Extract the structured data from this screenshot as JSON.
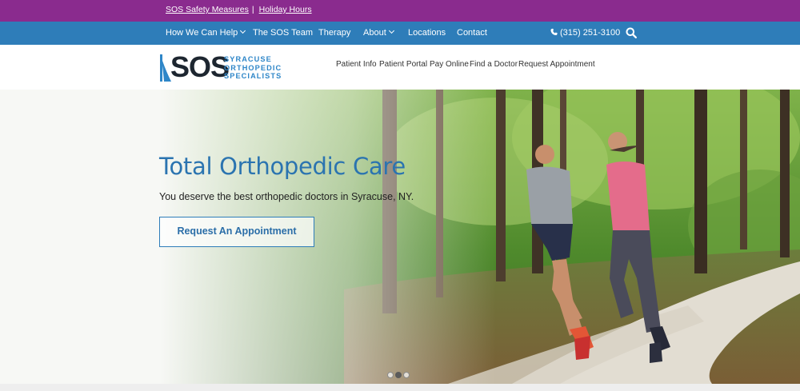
{
  "topbar": {
    "links": [
      "SOS Safety Measures",
      "Holiday Hours"
    ],
    "separator": "|"
  },
  "nav": {
    "items": [
      "How We Can Help",
      "The SOS Team",
      "Therapy",
      "About",
      "Locations",
      "Contact"
    ],
    "phone": "(315) 251-3100",
    "icons": {
      "phone": "phone-icon",
      "search": "search-icon"
    }
  },
  "header": {
    "logo_text": "SOS",
    "logo_sub": [
      "SYRACUSE",
      "ORTHOPEDIC",
      "SPECIALISTS"
    ],
    "subnav": [
      "Patient Info",
      "Patient Portal",
      "Pay Online",
      "Find a Doctor",
      "Request Appointment"
    ]
  },
  "hero": {
    "title": "Total Orthopedic Care",
    "subtitle": "You deserve the best orthopedic doctors in Syracuse, NY.",
    "button": "Request An Appointment",
    "carousel": {
      "slides": 3,
      "active": 2
    }
  },
  "colors": {
    "topbar": "#8a2b8e",
    "navbar": "#2e7db9",
    "accent": "#2b74b0",
    "logo_blue": "#2e86c8"
  }
}
